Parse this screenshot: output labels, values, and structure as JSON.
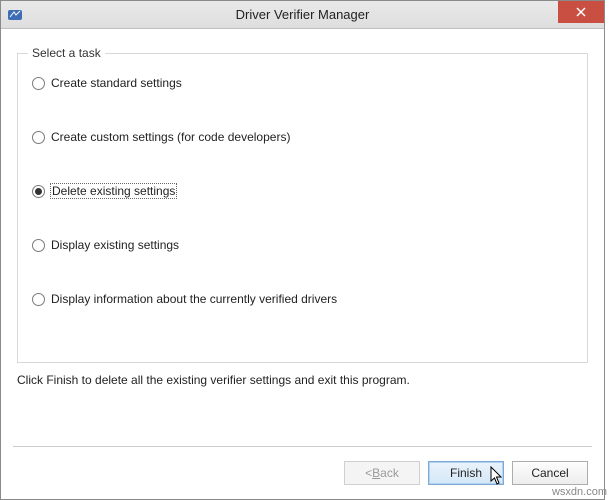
{
  "window": {
    "title": "Driver Verifier Manager"
  },
  "group": {
    "label": "Select a task",
    "selected_index": 2,
    "options": [
      {
        "label": "Create standard settings"
      },
      {
        "label": "Create custom settings (for code developers)"
      },
      {
        "label": "Delete existing settings"
      },
      {
        "label": "Display existing settings"
      },
      {
        "label": "Display information about the currently verified drivers"
      }
    ]
  },
  "instruction": "Click Finish to delete all the existing verifier settings and exit this program.",
  "buttons": {
    "back_prefix": "< ",
    "back_u": "B",
    "back_rest": "ack",
    "finish": "Finish",
    "cancel": "Cancel"
  },
  "watermark": "wsxdn.com"
}
